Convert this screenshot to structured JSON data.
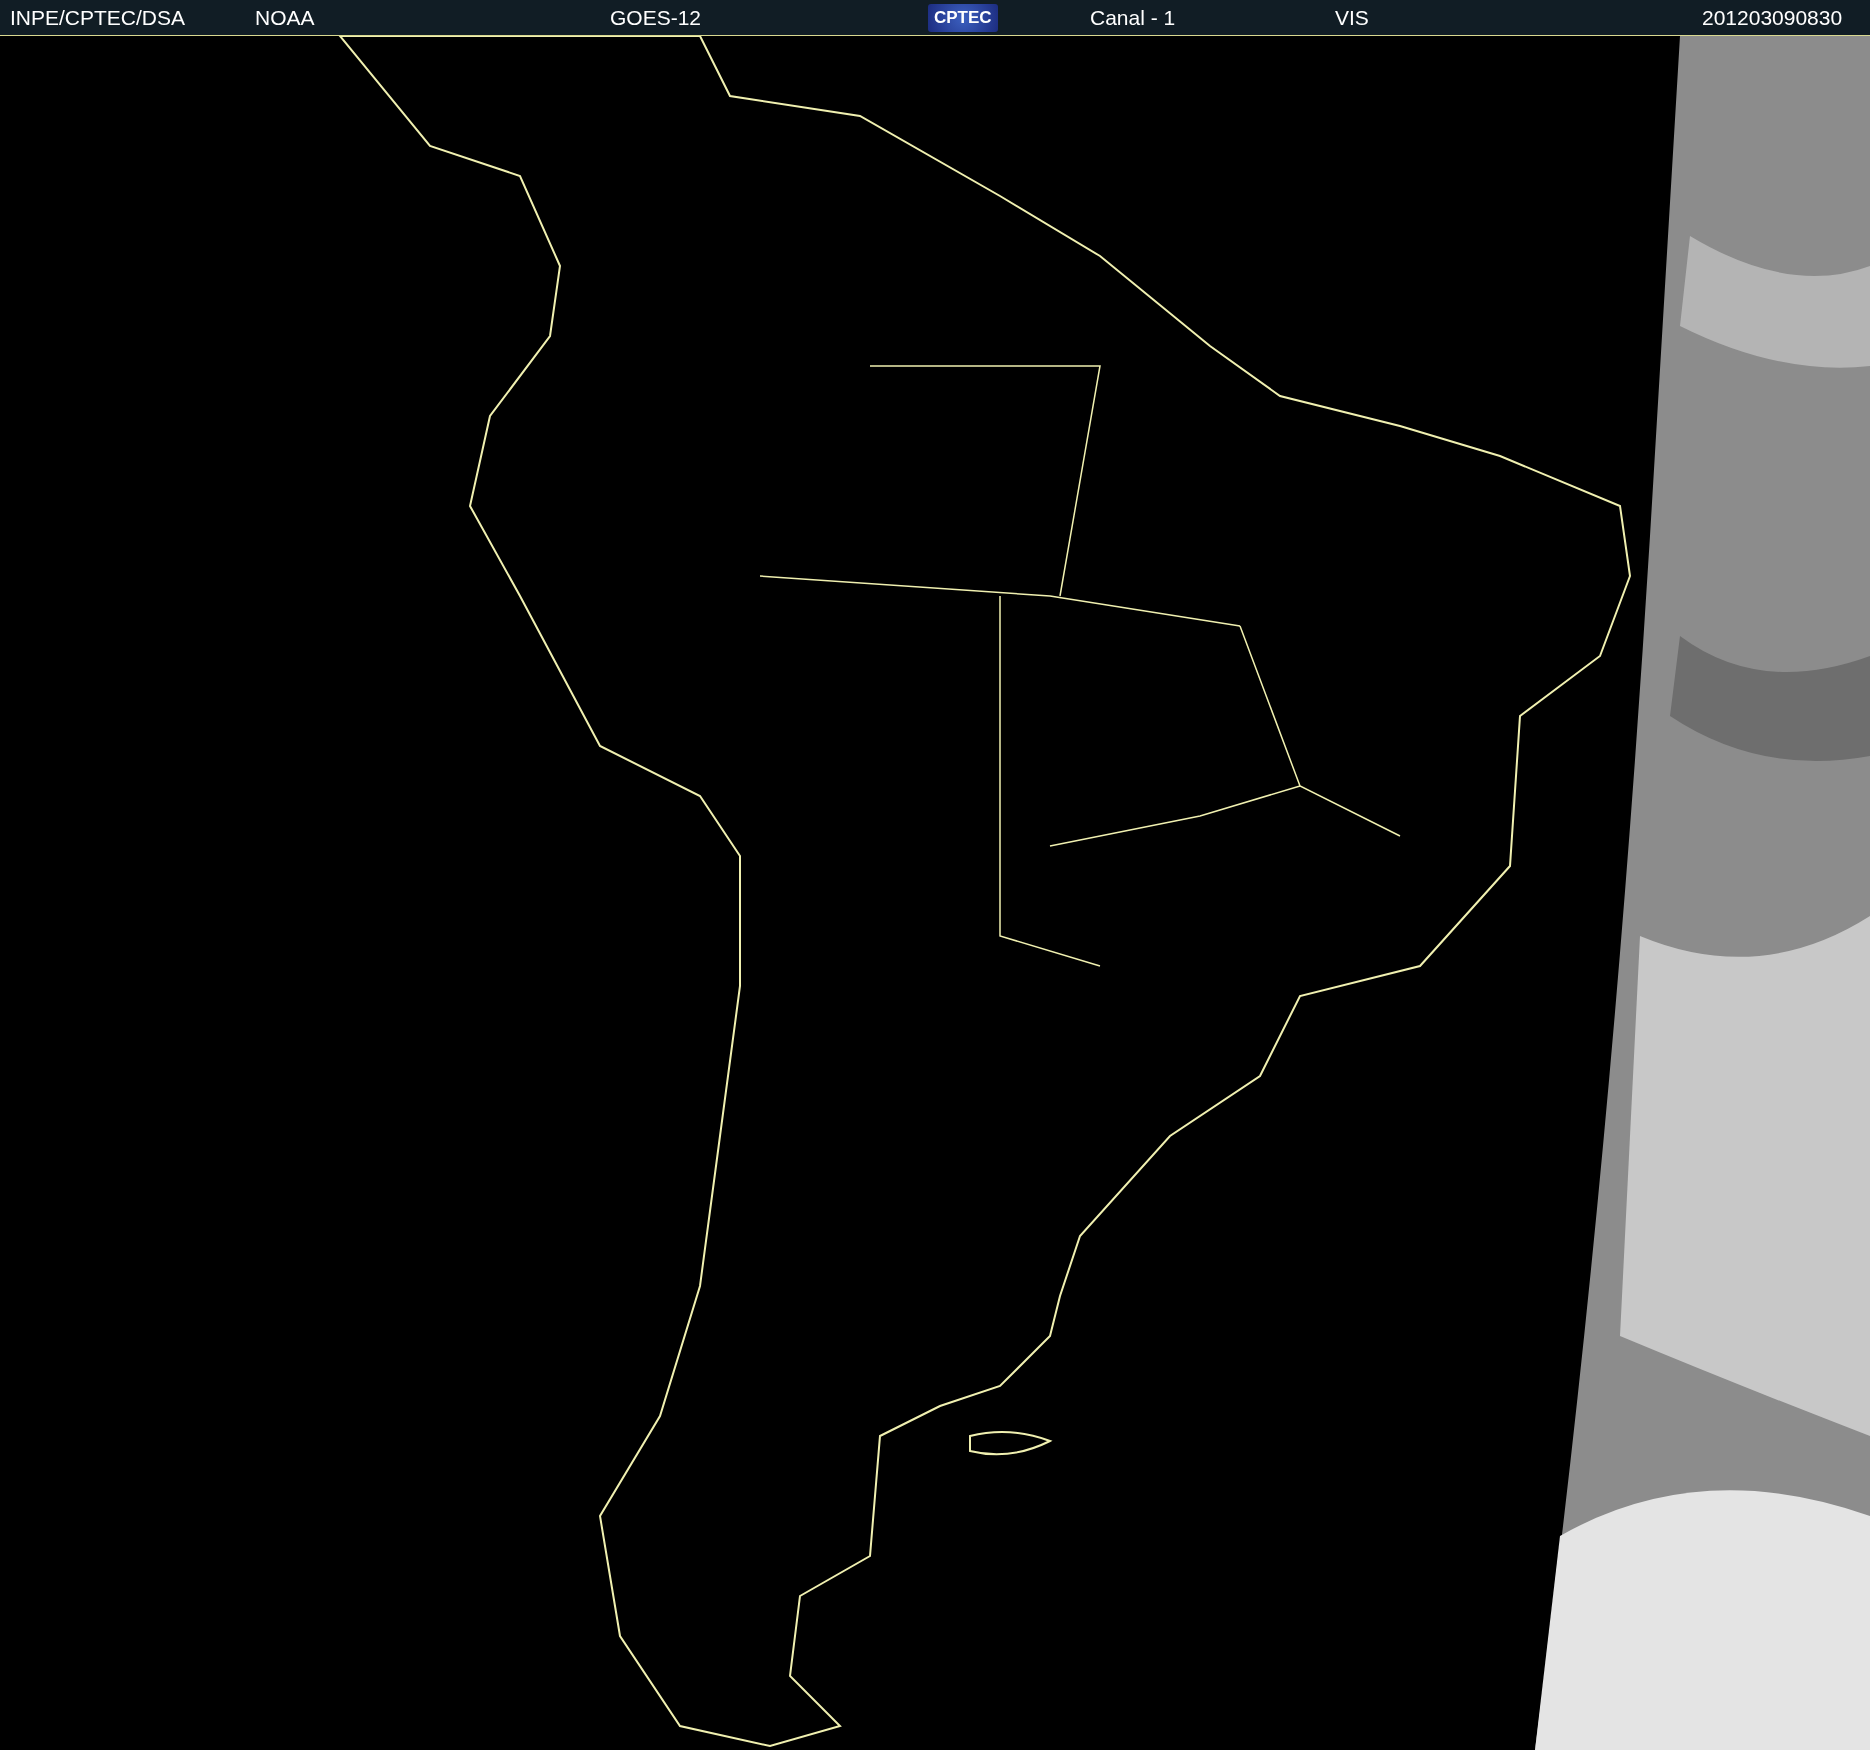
{
  "header": {
    "items": [
      {
        "kind": "text",
        "label": "INPE/CPTEC/DSA"
      },
      {
        "kind": "text",
        "label": "NOAA"
      },
      {
        "kind": "text",
        "label": "GOES-12"
      },
      {
        "kind": "logo",
        "label": "CPTEC"
      },
      {
        "kind": "text",
        "label": "Canal - 1"
      },
      {
        "kind": "text",
        "label": "VIS"
      },
      {
        "kind": "text",
        "label": "201203090830"
      }
    ]
  }
}
